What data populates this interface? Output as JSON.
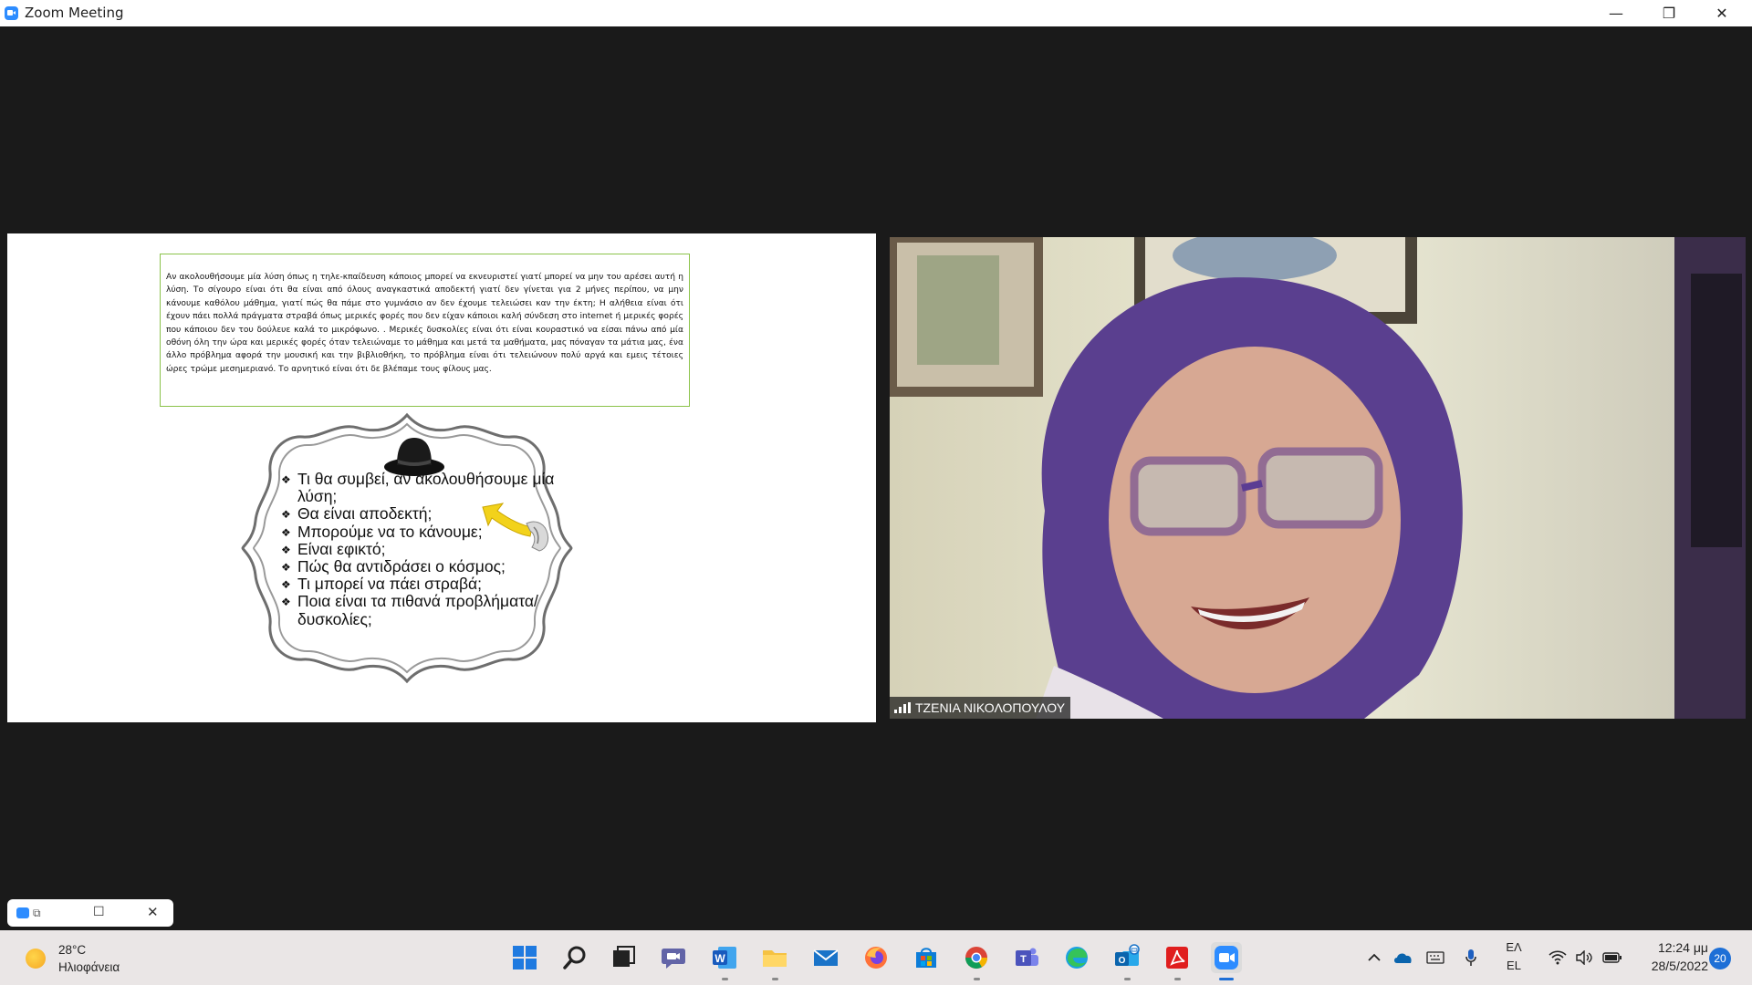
{
  "window": {
    "title": "Zoom Meeting",
    "minimize": "—",
    "restore": "❐",
    "close": "✕"
  },
  "slide": {
    "paragraph": "Αν ακολουθήσουμε μία λύση όπως η τηλε-κπαίδευση κάποιος μπορεί να εκνευριστεί γιατί μπορεί να μην του αρέσει αυτή η λύση. Το σίγουρο είναι ότι θα είναι από όλους αναγκαστικά αποδεκτή γιατί δεν γίνεται για 2 μήνες περίπου, να μην κάνουμε καθόλου μάθημα, γιατί πώς θα πάμε στο γυμνάσιο αν δεν έχουμε τελειώσει καν την έκτη; Η αλήθεια είναι ότι έχουν πάει πολλά πράγματα στραβά όπως μερικές φορές που δεν είχαν κάποιοι καλή σύνδεση στο internet ή μερικές φορές που κάποιου δεν του δούλευε καλά το μικρόφωνο. . Μερικές δυσκολίες είναι ότι είναι κουραστικό να είσαι πάνω από μία οθόνη όλη την ώρα και μερικές φορές όταν τελειώναμε το μάθημα και μετά τα μαθήματα, μας πόναγαν τα μάτια μας, ένα άλλο πρόβλημα αφορά την μουσική και την βιβλιοθήκη, το πρόβλημα είναι ότι τελειώνουν πολύ αργά και εμεις τέτοιες ώρες τρώμε μεσημεριανό. Το αρνητικό είναι ότι δε βλέπαμε τους φίλους μας.",
    "bullets": [
      "Τι θα συμβεί, αν ακολουθήσουμε μία λύση;",
      "Θα είναι αποδεκτή;",
      "Μπορούμε να το κάνουμε;",
      "Είναι εφικτό;",
      "Πώς θα αντιδράσει ο κόσμος;",
      "Τι μπορεί να πάει στραβά;",
      "Ποια είναι τα πιθανά προβλήματα/δυσκολίες;"
    ]
  },
  "participant": {
    "name": "ΤΖΕΝΙΑ ΝΙΚΟΛΟΠΟΥΛΟΥ"
  },
  "taskbar": {
    "weather": {
      "temp": "28°C",
      "desc": "Ηλιοφάνεια",
      "icon": "sun-icon"
    },
    "lang_top": "ΕΛ",
    "lang_bottom": "EL",
    "time": "12:24 μμ",
    "date": "28/5/2022",
    "notifications": "20",
    "apps": [
      "start",
      "search",
      "task-view",
      "teams-chat",
      "word",
      "file-explorer",
      "mail",
      "firefox",
      "store",
      "chrome",
      "teams",
      "edge",
      "outlook",
      "acrobat",
      "zoom"
    ]
  },
  "colors": {
    "zoom_blue": "#2d8cff",
    "background": "#1a1a1a",
    "taskbar": "#eae6e6"
  }
}
